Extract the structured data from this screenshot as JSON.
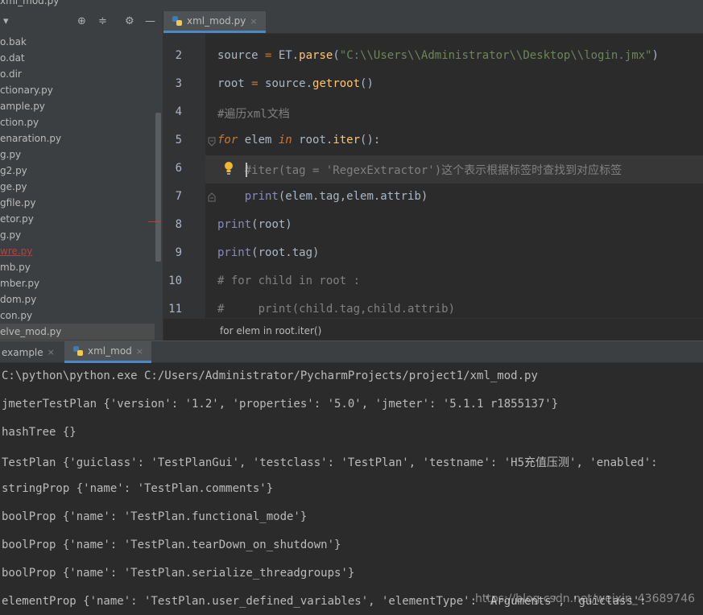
{
  "window": {
    "title": "xml_mod.py"
  },
  "project_panel": {
    "files": [
      {
        "name": "o.bak"
      },
      {
        "name": "o.dat"
      },
      {
        "name": "o.dir"
      },
      {
        "name": "ctionary.py"
      },
      {
        "name": "ample.py"
      },
      {
        "name": "ction.py"
      },
      {
        "name": "enaration.py"
      },
      {
        "name": "g.py"
      },
      {
        "name": "g2.py"
      },
      {
        "name": "ge.py"
      },
      {
        "name": "gfile.py"
      },
      {
        "name": "etor.py"
      },
      {
        "name": "g.py"
      },
      {
        "name": "wre.py"
      },
      {
        "name": "mb.py"
      },
      {
        "name": "mber.py"
      },
      {
        "name": "dom.py"
      },
      {
        "name": "con.py"
      },
      {
        "name": "elve_mod.py"
      }
    ]
  },
  "editor": {
    "tab": {
      "label": "xml_mod.py",
      "close": "×"
    },
    "lines": [
      {
        "n": "2",
        "parts": [
          [
            "",
            "source "
          ],
          [
            "kw",
            "= "
          ],
          [
            "",
            "ET."
          ],
          [
            "fn",
            "parse"
          ],
          [
            "",
            "("
          ],
          [
            "st",
            "\"C:\\\\Users\\\\Administrator\\\\Desktop\\\\login.jmx\""
          ],
          [
            "",
            ")"
          ]
        ]
      },
      {
        "n": "3",
        "parts": [
          [
            "",
            "root "
          ],
          [
            "kw",
            "= "
          ],
          [
            "",
            "source."
          ],
          [
            "fn",
            "getroot"
          ],
          [
            "",
            "()"
          ]
        ]
      },
      {
        "n": "4",
        "parts": [
          [
            "cm",
            "#遍历xml文档"
          ]
        ]
      },
      {
        "n": "5",
        "parts": [
          [
            "kwi",
            "for"
          ],
          [
            "",
            " elem "
          ],
          [
            "kwi",
            "in"
          ],
          [
            "",
            " root."
          ],
          [
            "fn",
            "iter"
          ],
          [
            "",
            "():"
          ]
        ]
      },
      {
        "n": "6",
        "parts": [
          [
            "cm",
            "    #iter(tag = 'RegexExtractor')这个表示根据标签时查找到对应标签"
          ]
        ]
      },
      {
        "n": "7",
        "parts": [
          [
            "",
            "    "
          ],
          [
            "bi",
            "print"
          ],
          [
            "",
            "(elem.tag,elem.attrib)"
          ]
        ]
      },
      {
        "n": "8",
        "parts": [
          [
            "bi",
            "print"
          ],
          [
            "",
            "(root)"
          ]
        ]
      },
      {
        "n": "9",
        "parts": [
          [
            "bi",
            "print"
          ],
          [
            "",
            "(root.tag)"
          ]
        ]
      },
      {
        "n": "10",
        "parts": [
          [
            "cm",
            "# for child in root :"
          ]
        ]
      },
      {
        "n": "11",
        "parts": [
          [
            "cm",
            "#     print(child.tag,child.attrib)"
          ]
        ]
      }
    ],
    "breadcrumb": "for elem in root.iter()"
  },
  "run_panel": {
    "tabs": [
      {
        "label": "example",
        "close": "×"
      },
      {
        "label": "xml_mod",
        "close": "×"
      }
    ],
    "output": [
      "C:\\python\\python.exe C:/Users/Administrator/PycharmProjects/project1/xml_mod.py",
      "jmeterTestPlan {'version': '1.2', 'properties': '5.0', 'jmeter': '5.1.1 r1855137'}",
      "hashTree {}",
      "TestPlan {'guiclass': 'TestPlanGui', 'testclass': 'TestPlan', 'testname': 'H5充值压测', 'enabled':",
      "stringProp {'name': 'TestPlan.comments'}",
      "boolProp {'name': 'TestPlan.functional_mode'}",
      "boolProp {'name': 'TestPlan.tearDown_on_shutdown'}",
      "boolProp {'name': 'TestPlan.serialize_threadgroups'}",
      "elementProp {'name': 'TestPlan.user_defined_variables', 'elementType': 'Arguments', 'guiclass':"
    ]
  },
  "watermark": "https://blog.csdn.net/weixin_43689746",
  "colors": {
    "accent": "#4a88c7",
    "keyword": "#cc7832",
    "string": "#6a8759",
    "function": "#ffc66d",
    "builtin": "#8888c6",
    "comment": "#808080"
  }
}
